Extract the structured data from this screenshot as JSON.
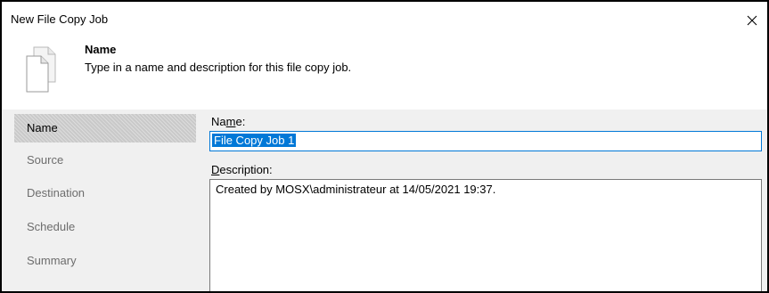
{
  "window": {
    "title": "New File Copy Job"
  },
  "header": {
    "title": "Name",
    "subtitle": "Type in a name and description for this file copy job.",
    "icon": "document-copy-icon"
  },
  "nav": {
    "items": [
      {
        "label": "Name",
        "active": true
      },
      {
        "label": "Source",
        "active": false
      },
      {
        "label": "Destination",
        "active": false
      },
      {
        "label": "Schedule",
        "active": false
      },
      {
        "label": "Summary",
        "active": false
      }
    ]
  },
  "form": {
    "name_label_prefix": "Na",
    "name_label_mnemonic": "m",
    "name_label_suffix": "e:",
    "name_value": "File Copy Job 1",
    "desc_label_mnemonic": "D",
    "desc_label_suffix": "escription:",
    "desc_value": "Created by MOSX\\administrateur at 14/05/2021 19:37."
  },
  "colors": {
    "accent": "#0078d7",
    "nav_active": "#c9c9c9",
    "panel_bg": "#f0f0f0"
  }
}
